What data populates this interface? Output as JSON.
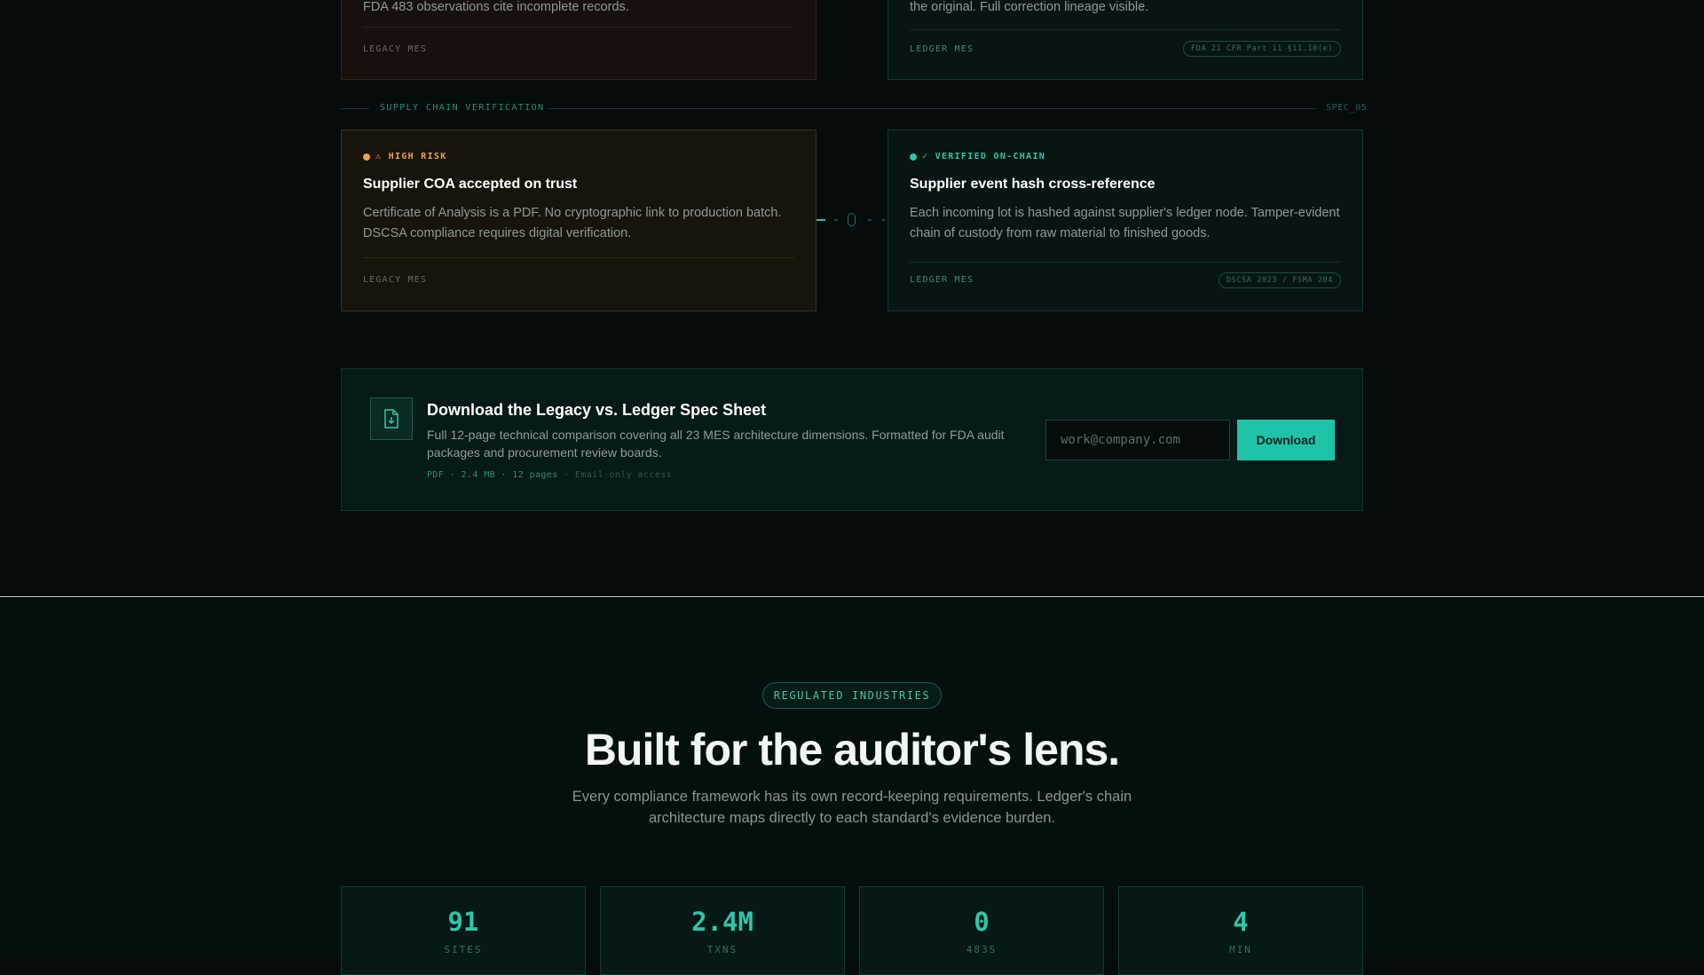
{
  "top_row": {
    "legacy": {
      "desc_tail": "FDA 483 observations cite incomplete records.",
      "footer": "LEGACY MES"
    },
    "ledger": {
      "desc_tail": "the original. Full correction lineage visible.",
      "footer": "LEDGER MES",
      "tag": "FDA 21 CFR Part 11 §11.10(e)"
    }
  },
  "section": {
    "title": "SUPPLY CHAIN VERIFICATION",
    "spec": "SPEC_05"
  },
  "supply_chain": {
    "legacy": {
      "status": "⚠ HIGH RISK",
      "title": "Supplier COA accepted on trust",
      "desc": "Certificate of Analysis is a PDF. No cryptographic link to production batch. DSCSA compliance requires digital verification.",
      "footer": "LEGACY MES"
    },
    "ledger": {
      "status": "✓ VERIFIED ON-CHAIN",
      "title": "Supplier event hash cross-reference",
      "desc": "Each incoming lot is hashed against supplier's ledger node. Tamper-evident chain of custody from raw material to finished goods.",
      "footer": "LEDGER MES",
      "tag": "DSCSA 2023 / FSMA 204"
    }
  },
  "download": {
    "title": "Download the Legacy vs. Ledger Spec Sheet",
    "desc": "Full 12-page technical comparison covering all 23 MES architecture dimensions. Formatted for FDA audit packages and procurement review boards.",
    "meta": "PDF · 2.4 MB · 12 pages",
    "meta_muted": "· Email-only access",
    "email_placeholder": "work@company.com",
    "button": "Download"
  },
  "industries": {
    "badge": "REGULATED INDUSTRIES",
    "heading": "Built for the auditor's lens.",
    "subheading": "Every compliance framework has its own record-keeping requirements. Ledger's chain architecture maps directly to each standard's evidence burden.",
    "stats": [
      {
        "value": "91",
        "label": "SITES"
      },
      {
        "value": "2.4M",
        "label": "TXNS"
      },
      {
        "value": "0",
        "label": "483S"
      },
      {
        "value": "4",
        "label": "MIN"
      }
    ]
  },
  "colors": {
    "accent": "#1fc4a8",
    "risk": "#e8a24a",
    "verified": "#2fc5a8"
  }
}
